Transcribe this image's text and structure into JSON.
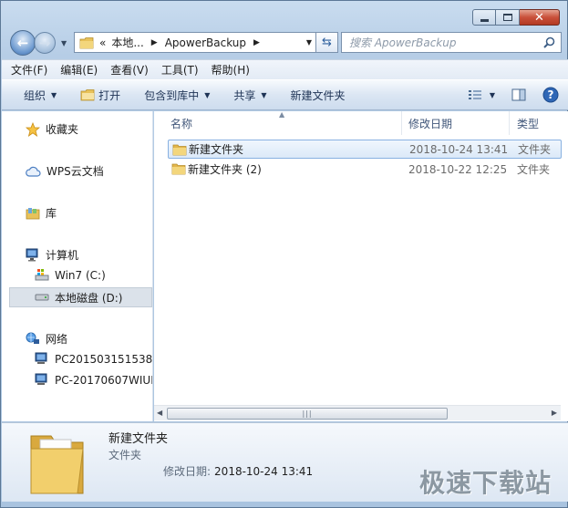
{
  "window": {
    "minimize": "minimize",
    "maximize": "maximize",
    "close": "close"
  },
  "address": {
    "prefix": "«",
    "crumbs": [
      "本地...",
      "ApowerBackup"
    ],
    "search_placeholder": "搜索 ApowerBackup"
  },
  "menu": [
    "文件(F)",
    "编辑(E)",
    "查看(V)",
    "工具(T)",
    "帮助(H)"
  ],
  "commands": {
    "organize": "组织",
    "open": "打开",
    "include_library": "包含到库中",
    "share": "共享",
    "new_folder": "新建文件夹"
  },
  "sidebar": {
    "favorites": "收藏夹",
    "wps_cloud": "WPS云文档",
    "library": "库",
    "computer": "计算机",
    "drive_c": "Win7 (C:)",
    "drive_d": "本地磁盘 (D:)",
    "network": "网络",
    "pc1": "PC201503151538",
    "pc2": "PC-20170607WIUN"
  },
  "columns": {
    "name": "名称",
    "modified": "修改日期",
    "type": "类型"
  },
  "files": [
    {
      "name": "新建文件夹",
      "modified": "2018-10-24 13:41",
      "type": "文件夹"
    },
    {
      "name": "新建文件夹 (2)",
      "modified": "2018-10-22 12:25",
      "type": "文件夹"
    }
  ],
  "details": {
    "name": "新建文件夹",
    "type": "文件夹",
    "modified_label": "修改日期:",
    "modified_value": "2018-10-24 13:41"
  },
  "watermark": "极速下载站",
  "colors": {
    "selection_border": "#88b1e1",
    "folder": "#e8c25a"
  }
}
